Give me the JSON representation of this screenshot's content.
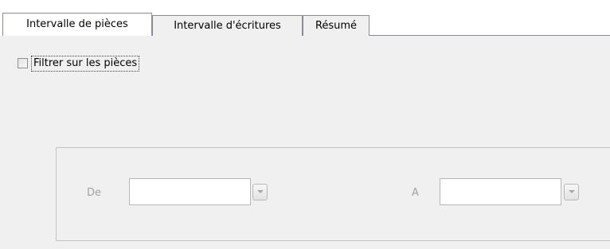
{
  "tabs": [
    {
      "label": "Intervalle de pièces",
      "selected": true
    },
    {
      "label": "Intervalle d'écritures",
      "selected": false
    },
    {
      "label": "Résumé",
      "selected": false
    }
  ],
  "filter": {
    "label": "Filtrer sur les pièces",
    "checked": false
  },
  "range": {
    "from_label": "De",
    "to_label": "A",
    "from_value": "",
    "to_value": "",
    "enabled": false
  },
  "colors": {
    "panel_background": "#f0f0f0",
    "tab_border": "#898c95",
    "disabled_text": "#a2a2a2"
  },
  "icons": {
    "dropdown": "chevron-down-icon"
  }
}
